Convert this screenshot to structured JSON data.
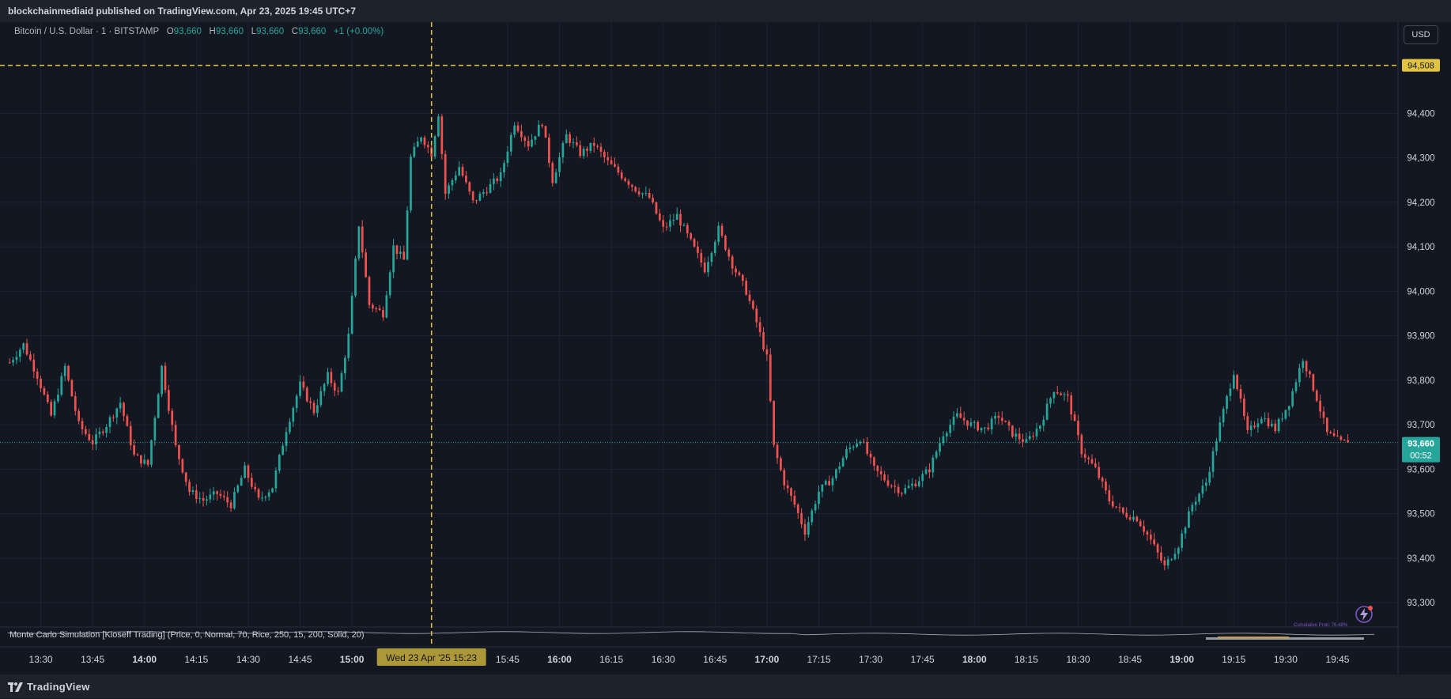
{
  "header": {
    "published_text": "blockchainmediaid published on TradingView.com, Apr 23, 2025 19:45 UTC+7"
  },
  "legend": {
    "symbol": "Bitcoin / U.S. Dollar · 1 · BITSTAMP",
    "open_label": "O",
    "open": "93,660",
    "high_label": "H",
    "high": "93,660",
    "low_label": "L",
    "low": "93,660",
    "close_label": "C",
    "close": "93,660",
    "change": "+1 (+0.00%)"
  },
  "currency_button": "USD",
  "indicator": {
    "label": "Monte Carlo Simulation [Kioseff Trading] (Price, 0, Normal, 70, Rice, 250, 15, 200, Solid, 20)",
    "cumulative_label": "Cumulative Prob: 76.48%"
  },
  "crosshair": {
    "price_label": "94,508",
    "time_label": "Wed 23 Apr '25   15:23"
  },
  "last_price": {
    "price": "93,660",
    "countdown": "00:52"
  },
  "footer": {
    "brand": "TradingView"
  },
  "colors": {
    "background": "#131722",
    "up": "#26a69a",
    "down": "#ef5350",
    "crosshair": "#e0c341",
    "grid": "#1f2330"
  },
  "chart_data": {
    "type": "candlestick",
    "y_ticks": [
      "94,400",
      "94,300",
      "94,200",
      "94,100",
      "94,000",
      "93,900",
      "93,800",
      "93,700",
      "93,600",
      "93,500",
      "93,400",
      "93,300"
    ],
    "y_tick_values": [
      94400,
      94300,
      94200,
      94100,
      94000,
      93900,
      93800,
      93700,
      93600,
      93500,
      93400,
      93300
    ],
    "ylim": [
      93245,
      94605
    ],
    "x_ticks": [
      "13:30",
      "13:45",
      "14:00",
      "14:15",
      "14:30",
      "14:45",
      "15:00",
      "15:45",
      "16:00",
      "16:15",
      "16:30",
      "16:45",
      "17:00",
      "17:15",
      "17:30",
      "17:45",
      "18:00",
      "18:15",
      "18:30",
      "18:45",
      "19:00",
      "19:15",
      "19:30",
      "19:45"
    ],
    "x_tick_minutes": [
      810,
      825,
      840,
      855,
      870,
      885,
      900,
      945,
      960,
      975,
      990,
      1005,
      1020,
      1035,
      1050,
      1065,
      1080,
      1095,
      1110,
      1125,
      1140,
      1155,
      1170,
      1185
    ],
    "bold_x_ticks": [
      "14:00",
      "15:00",
      "16:00",
      "17:00",
      "18:00",
      "19:00"
    ],
    "xlim_minutes": [
      800.5,
      1202.5
    ],
    "anchors": [
      [
        801,
        93840
      ],
      [
        805,
        93880
      ],
      [
        809,
        93810
      ],
      [
        813,
        93720
      ],
      [
        817,
        93830
      ],
      [
        821,
        93700
      ],
      [
        825,
        93660
      ],
      [
        829,
        93700
      ],
      [
        833,
        93750
      ],
      [
        837,
        93630
      ],
      [
        841,
        93610
      ],
      [
        845,
        93830
      ],
      [
        849,
        93650
      ],
      [
        853,
        93550
      ],
      [
        857,
        93530
      ],
      [
        861,
        93545
      ],
      [
        865,
        93520
      ],
      [
        869,
        93600
      ],
      [
        873,
        93530
      ],
      [
        877,
        93560
      ],
      [
        881,
        93690
      ],
      [
        885,
        93790
      ],
      [
        889,
        93730
      ],
      [
        893,
        93810
      ],
      [
        896,
        93770
      ],
      [
        899,
        93900
      ],
      [
        902,
        94150
      ],
      [
        905,
        93970
      ],
      [
        909,
        93950
      ],
      [
        912,
        94100
      ],
      [
        915,
        94070
      ],
      [
        917,
        94300
      ],
      [
        920,
        94350
      ],
      [
        923,
        94310
      ],
      [
        925,
        94400
      ],
      [
        927,
        94220
      ],
      [
        931,
        94280
      ],
      [
        935,
        94200
      ],
      [
        939,
        94230
      ],
      [
        943,
        94260
      ],
      [
        947,
        94380
      ],
      [
        951,
        94330
      ],
      [
        955,
        94380
      ],
      [
        958,
        94250
      ],
      [
        962,
        94350
      ],
      [
        966,
        94310
      ],
      [
        970,
        94330
      ],
      [
        974,
        94290
      ],
      [
        978,
        94260
      ],
      [
        982,
        94230
      ],
      [
        986,
        94210
      ],
      [
        990,
        94140
      ],
      [
        994,
        94170
      ],
      [
        998,
        94110
      ],
      [
        1002,
        94050
      ],
      [
        1006,
        94140
      ],
      [
        1010,
        94060
      ],
      [
        1014,
        94000
      ],
      [
        1017,
        93930
      ],
      [
        1020,
        93850
      ],
      [
        1022,
        93650
      ],
      [
        1025,
        93570
      ],
      [
        1028,
        93520
      ],
      [
        1031,
        93460
      ],
      [
        1035,
        93550
      ],
      [
        1039,
        93580
      ],
      [
        1043,
        93640
      ],
      [
        1047,
        93670
      ],
      [
        1051,
        93600
      ],
      [
        1055,
        93570
      ],
      [
        1059,
        93550
      ],
      [
        1063,
        93570
      ],
      [
        1067,
        93600
      ],
      [
        1071,
        93680
      ],
      [
        1075,
        93720
      ],
      [
        1079,
        93700
      ],
      [
        1083,
        93690
      ],
      [
        1087,
        93720
      ],
      [
        1091,
        93680
      ],
      [
        1095,
        93660
      ],
      [
        1099,
        93700
      ],
      [
        1103,
        93780
      ],
      [
        1107,
        93760
      ],
      [
        1111,
        93640
      ],
      [
        1115,
        93600
      ],
      [
        1119,
        93530
      ],
      [
        1123,
        93500
      ],
      [
        1127,
        93490
      ],
      [
        1131,
        93440
      ],
      [
        1135,
        93380
      ],
      [
        1139,
        93430
      ],
      [
        1143,
        93520
      ],
      [
        1147,
        93570
      ],
      [
        1151,
        93700
      ],
      [
        1155,
        93820
      ],
      [
        1159,
        93680
      ],
      [
        1163,
        93720
      ],
      [
        1167,
        93690
      ],
      [
        1171,
        93750
      ],
      [
        1175,
        93850
      ],
      [
        1179,
        93760
      ],
      [
        1182,
        93680
      ],
      [
        1186,
        93660
      ],
      [
        1188,
        93660
      ]
    ],
    "last_close": 93660,
    "crosshair_price": 94508,
    "crosshair_time_minutes": 923
  }
}
